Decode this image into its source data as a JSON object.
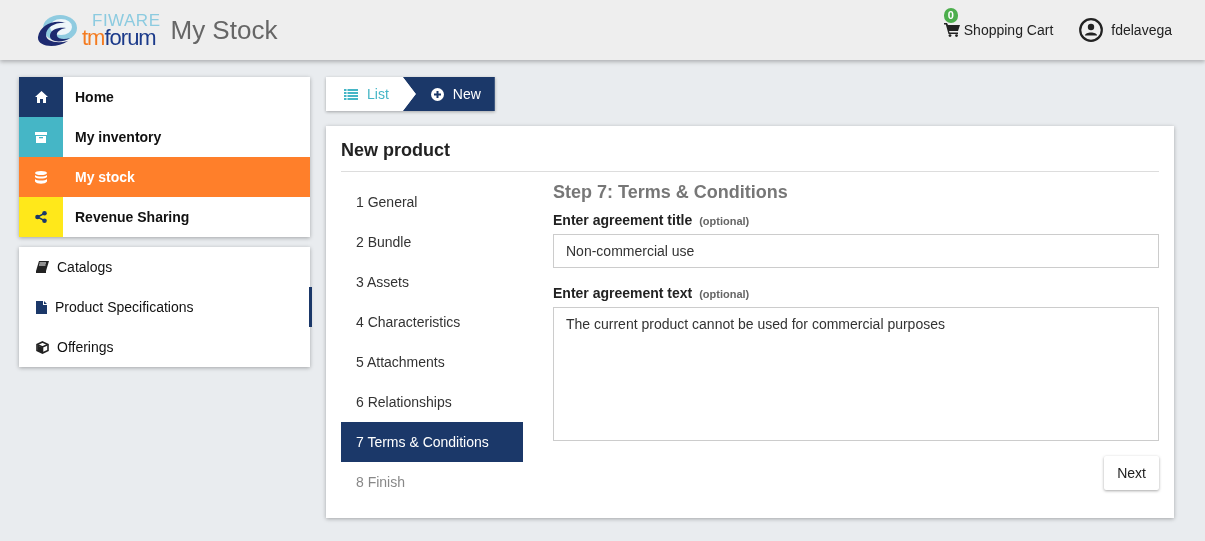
{
  "header": {
    "logo": {
      "top": "FIWARE",
      "bottom": "tmforum"
    },
    "title": "My Stock",
    "cart": {
      "label": "Shopping Cart",
      "count": "0"
    },
    "user": "fdelavega"
  },
  "main_nav": [
    {
      "label": "Home",
      "color": "#1b3869",
      "selected": false,
      "kind": "home"
    },
    {
      "label": "My inventory",
      "color": "#45b6c6",
      "selected": false,
      "kind": "archive"
    },
    {
      "label": "My stock",
      "color": "#ff7f2a",
      "selected": true,
      "kind": "database"
    },
    {
      "label": "Revenue Sharing",
      "color": "#ffe81a",
      "selected": false,
      "kind": "share"
    }
  ],
  "sub_nav": [
    {
      "label": "Catalogs",
      "selected": false,
      "kind": "book"
    },
    {
      "label": "Product Specifications",
      "selected": true,
      "kind": "file"
    },
    {
      "label": "Offerings",
      "selected": false,
      "kind": "cube"
    }
  ],
  "breadcrumb": [
    {
      "label": "List",
      "selected": false,
      "kind": "list"
    },
    {
      "label": "New",
      "selected": true,
      "kind": "plus"
    }
  ],
  "panel": {
    "title": "New product",
    "steps": [
      {
        "label": "1 General",
        "selected": false,
        "disabled": false
      },
      {
        "label": "2 Bundle",
        "selected": false,
        "disabled": false
      },
      {
        "label": "3 Assets",
        "selected": false,
        "disabled": false
      },
      {
        "label": "4 Characteristics",
        "selected": false,
        "disabled": false
      },
      {
        "label": "5 Attachments",
        "selected": false,
        "disabled": false
      },
      {
        "label": "6 Relationships",
        "selected": false,
        "disabled": false
      },
      {
        "label": "7 Terms & Conditions",
        "selected": true,
        "disabled": false
      },
      {
        "label": "8 Finish",
        "selected": false,
        "disabled": true
      }
    ],
    "step_title": "Step 7: Terms & Conditions",
    "fields": [
      {
        "kind": "input",
        "label": "Enter agreement title",
        "hint": "(optional)",
        "value": "Non-commercial use"
      },
      {
        "kind": "textarea",
        "label": "Enter agreement text",
        "hint": "(optional)",
        "value": "The current product cannot be used for commercial purposes"
      }
    ],
    "next_button": "Next"
  }
}
